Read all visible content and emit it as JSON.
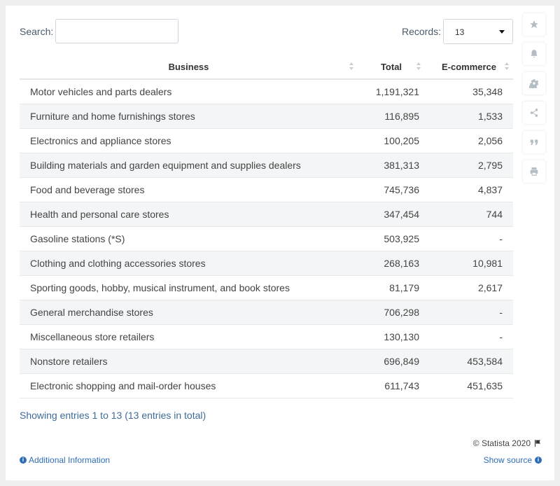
{
  "search": {
    "label": "Search:",
    "value": ""
  },
  "records": {
    "label": "Records:",
    "value": "13"
  },
  "toolbar": [
    "star-icon",
    "bell-icon",
    "gear-icon",
    "share-icon",
    "quote-icon",
    "print-icon"
  ],
  "chart_data": {
    "type": "table",
    "columns": [
      "Business",
      "Total",
      "E-commerce"
    ],
    "rows": [
      [
        "Motor vehicles and parts dealers",
        "1,191,321",
        "35,348"
      ],
      [
        "Furniture and home furnishings stores",
        "116,895",
        "1,533"
      ],
      [
        "Electronics and appliance stores",
        "100,205",
        "2,056"
      ],
      [
        "Building materials and garden equipment and supplies dealers",
        "381,313",
        "2,795"
      ],
      [
        "Food and beverage stores",
        "745,736",
        "4,837"
      ],
      [
        "Health and personal care stores",
        "347,454",
        "744"
      ],
      [
        "Gasoline stations (*S)",
        "503,925",
        "-"
      ],
      [
        "Clothing and clothing accessories stores",
        "268,163",
        "10,981"
      ],
      [
        "Sporting goods, hobby, musical instrument, and book stores",
        "81,179",
        "2,617"
      ],
      [
        "General merchandise stores",
        "706,298",
        "-"
      ],
      [
        "Miscellaneous store retailers",
        "130,130",
        "-"
      ],
      [
        "Nonstore retailers",
        "696,849",
        "453,584"
      ],
      [
        "Electronic shopping and mail-order houses",
        "611,743",
        "451,635"
      ]
    ]
  },
  "footer": {
    "summary": "Showing entries 1 to 13 (13 entries in total)",
    "copyright": "© Statista 2020",
    "additional_info": "Additional Information",
    "show_source": "Show source"
  },
  "colors": {
    "link": "#2f6eb5",
    "row_alt": "#f3f5f7"
  }
}
